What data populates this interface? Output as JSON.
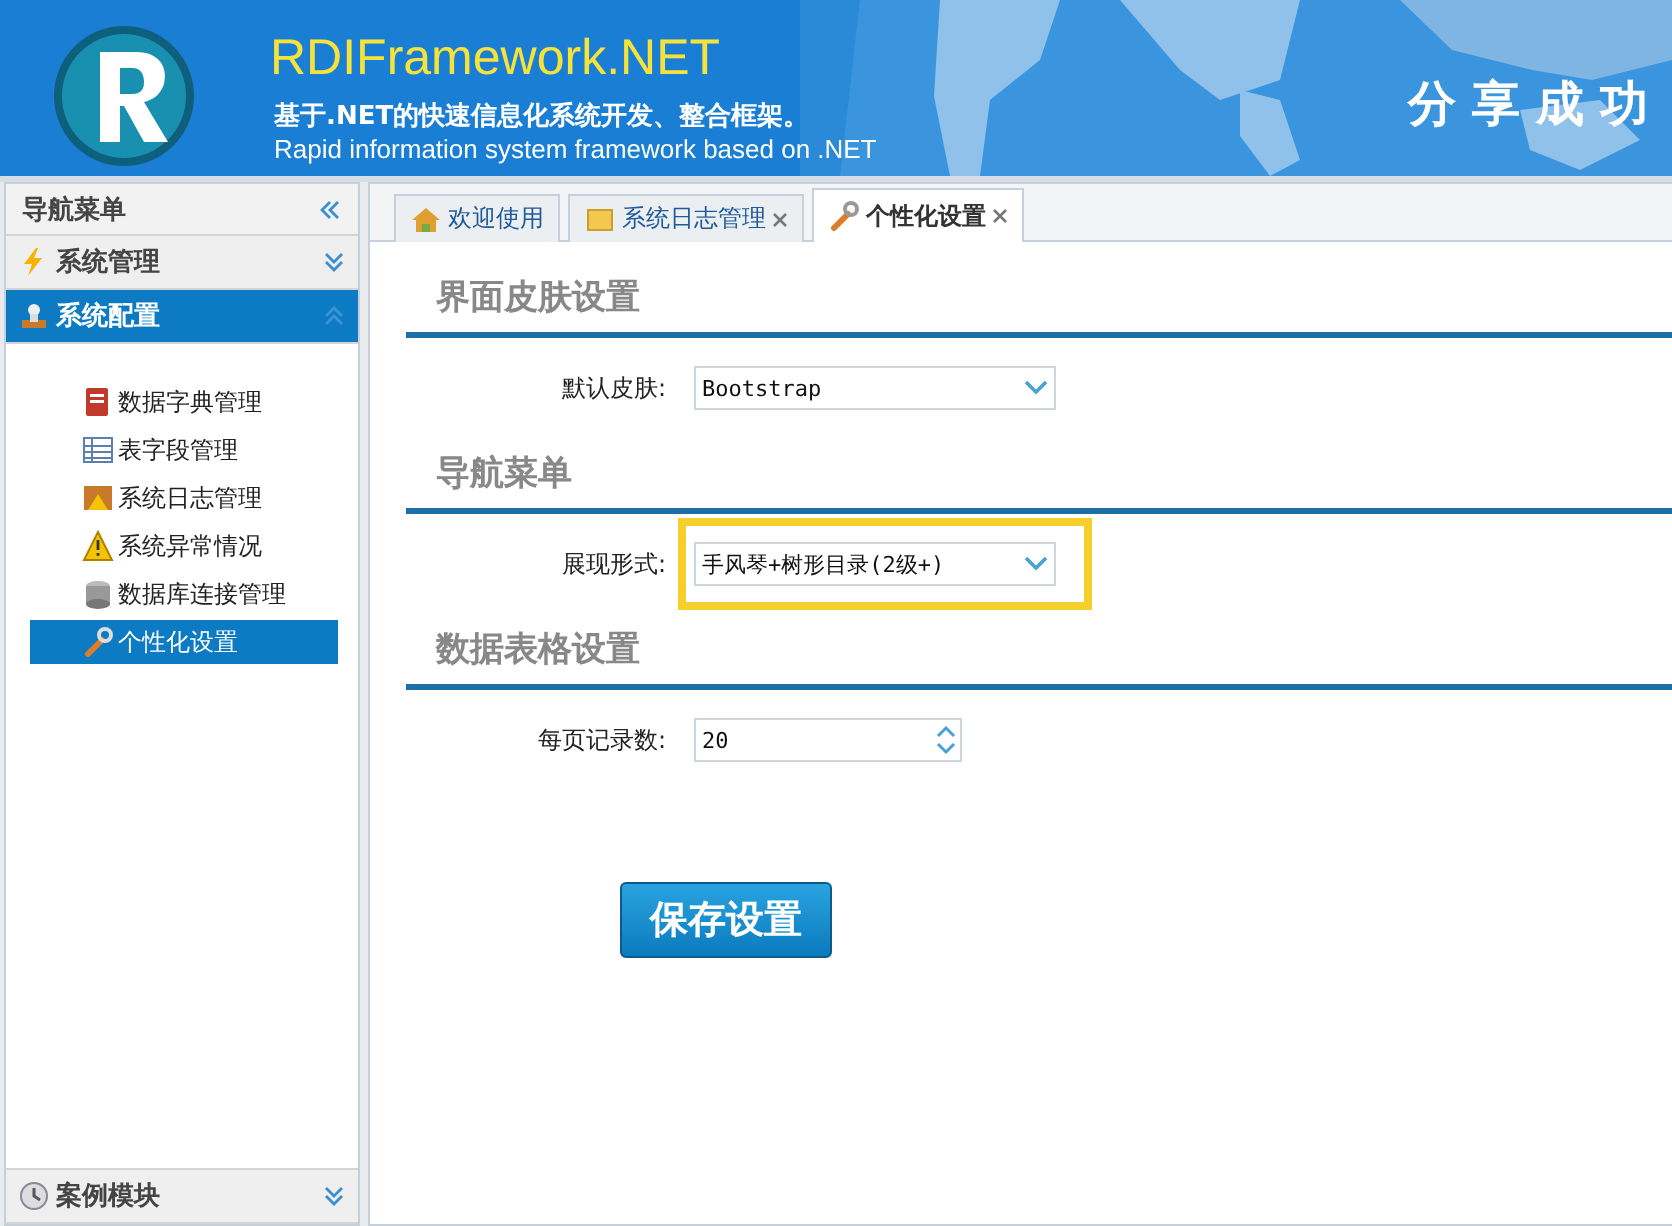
{
  "header": {
    "title": "RDIFramework.NET",
    "subtitle": "基于.NET的快速信息化系统开发、整合框架。",
    "subtitle_en": "Rapid information system framework based on .NET",
    "slogan": "分享成功"
  },
  "sidebar": {
    "title": "导航菜单",
    "panels": [
      {
        "title": "系统管理",
        "expanded": false
      },
      {
        "title": "系统配置",
        "expanded": true,
        "items": [
          {
            "label": "数据字典管理",
            "selected": false
          },
          {
            "label": "表字段管理",
            "selected": false
          },
          {
            "label": "系统日志管理",
            "selected": false
          },
          {
            "label": "系统异常情况",
            "selected": false
          },
          {
            "label": "数据库连接管理",
            "selected": false
          },
          {
            "label": "个性化设置",
            "selected": true
          }
        ]
      },
      {
        "title": "案例模块",
        "expanded": false
      }
    ]
  },
  "tabs": [
    {
      "label": "欢迎使用",
      "closable": false,
      "selected": false
    },
    {
      "label": "系统日志管理",
      "closable": true,
      "selected": false
    },
    {
      "label": "个性化设置",
      "closable": true,
      "selected": true
    }
  ],
  "sections": [
    {
      "title": "界面皮肤设置",
      "fields": [
        {
          "label": "默认皮肤:",
          "kind": "select",
          "value": "Bootstrap",
          "highlighted": false
        }
      ]
    },
    {
      "title": "导航菜单",
      "fields": [
        {
          "label": "展现形式:",
          "kind": "select",
          "value": "手风琴+树形目录(2级+)",
          "highlighted": true
        }
      ]
    },
    {
      "title": "数据表格设置",
      "fields": [
        {
          "label": "每页记录数:",
          "kind": "spinner",
          "value": "20",
          "highlighted": false
        }
      ]
    }
  ],
  "save_button": "保存设置"
}
